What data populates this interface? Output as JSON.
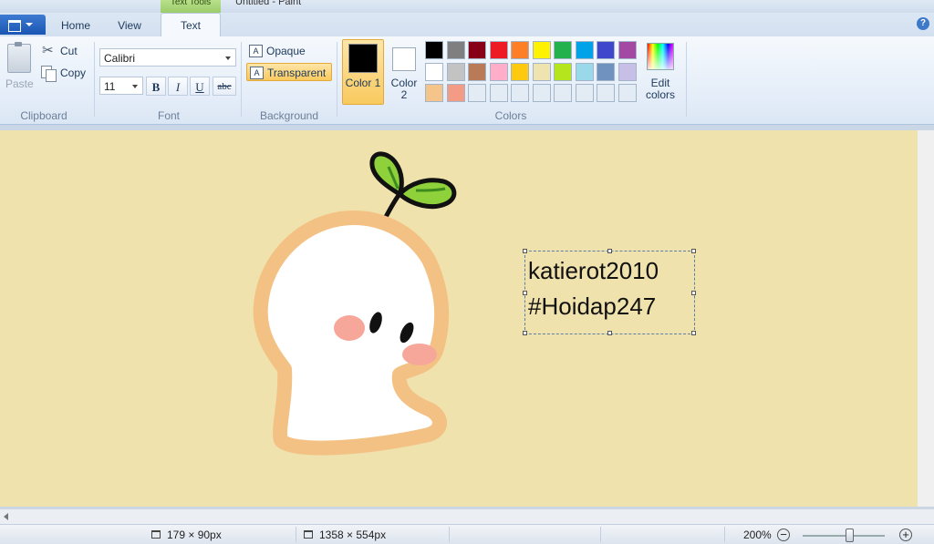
{
  "window": {
    "contextual_tab": "Text Tools",
    "document_title": "Untitled - Paint"
  },
  "tabs": [
    {
      "label": "Home"
    },
    {
      "label": "View"
    },
    {
      "label": "Text",
      "active": true
    }
  ],
  "clipboard": {
    "group": "Clipboard",
    "paste": "Paste",
    "cut": "Cut",
    "copy": "Copy"
  },
  "font": {
    "group": "Font",
    "family": "Calibri",
    "size": "11",
    "bold": "B",
    "italic": "I",
    "underline": "U",
    "strike": "abc"
  },
  "background": {
    "group": "Background",
    "opaque": "Opaque",
    "transparent": "Transparent",
    "selected": "Transparent"
  },
  "colors": {
    "group": "Colors",
    "color1_label": "Color 1",
    "color2_label": "Color 2",
    "color1": "#000000",
    "color2": "#ffffff",
    "edit_label": "Edit colors",
    "palette": [
      "#000000",
      "#7f7f7f",
      "#880015",
      "#ed1c24",
      "#ff7f27",
      "#fff200",
      "#22b14c",
      "#00a2e8",
      "#3f48cc",
      "#a349a4",
      "#ffffff",
      "#c3c3c3",
      "#b97a57",
      "#ffaec9",
      "#ffc90e",
      "#efe4b0",
      "#b5e61d",
      "#99d9ea",
      "#7092be",
      "#c8bfe7",
      "#f5c48a",
      "#f39b84",
      "#e3ebf5",
      "#e3ebf5",
      "#e3ebf5",
      "#e3ebf5",
      "#e3ebf5",
      "#e3ebf5",
      "#e3ebf5",
      "#e3ebf5"
    ]
  },
  "canvas": {
    "background": "#efe2ad",
    "text_lines": [
      "katierot2010",
      "#Hoidap247"
    ]
  },
  "status": {
    "selection_size": "179 × 90px",
    "image_size": "1358 × 554px",
    "zoom": "200%"
  }
}
